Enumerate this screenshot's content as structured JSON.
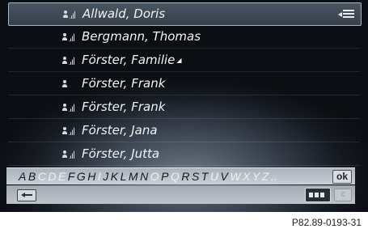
{
  "contacts": [
    {
      "name": "Allwald, Doris",
      "icon": "contact-phonebook-icon",
      "more": ""
    },
    {
      "name": "Bergmann, Thomas",
      "icon": "contact-phonebook-icon",
      "more": ""
    },
    {
      "name": "Förster, Familie",
      "icon": "contact-phonebook-icon",
      "more": "◢"
    },
    {
      "name": "Förster, Frank",
      "icon": "contact-person-icon",
      "more": ""
    },
    {
      "name": "Förster, Frank",
      "icon": "contact-phonebook-icon",
      "more": ""
    },
    {
      "name": "Förster, Jana",
      "icon": "contact-phonebook-icon",
      "more": ""
    },
    {
      "name": "Förster, Jutta",
      "icon": "contact-phonebook-icon",
      "more": ""
    }
  ],
  "selected_index": 0,
  "keyboard": {
    "letters": [
      {
        "c": "A",
        "on": true
      },
      {
        "c": "B",
        "on": true
      },
      {
        "c": "C",
        "on": false
      },
      {
        "c": "D",
        "on": false
      },
      {
        "c": "E",
        "on": false
      },
      {
        "c": "F",
        "on": true
      },
      {
        "c": "G",
        "on": true
      },
      {
        "c": "H",
        "on": true
      },
      {
        "c": "I",
        "on": false
      },
      {
        "c": "J",
        "on": true
      },
      {
        "c": "K",
        "on": true
      },
      {
        "c": "L",
        "on": true
      },
      {
        "c": "M",
        "on": true
      },
      {
        "c": "N",
        "on": true
      },
      {
        "c": "O",
        "on": false
      },
      {
        "c": "P",
        "on": true
      },
      {
        "c": "Q",
        "on": false
      },
      {
        "c": "R",
        "on": true
      },
      {
        "c": "S",
        "on": true
      },
      {
        "c": "T",
        "on": true
      },
      {
        "c": "U",
        "on": false
      },
      {
        "c": "V",
        "on": true
      },
      {
        "c": "W",
        "on": false
      },
      {
        "c": "X",
        "on": false
      },
      {
        "c": "Y",
        "on": false
      },
      {
        "c": "Z",
        "on": false
      },
      {
        "c": "..",
        "on": false
      }
    ],
    "ok_label": "ok",
    "c_label": "c"
  },
  "caption": "P82.89-0193-31",
  "colors": {
    "active_letter": "#161a1f",
    "inactive_letter": "#eef1f4",
    "screen_bg": "#161b22"
  }
}
